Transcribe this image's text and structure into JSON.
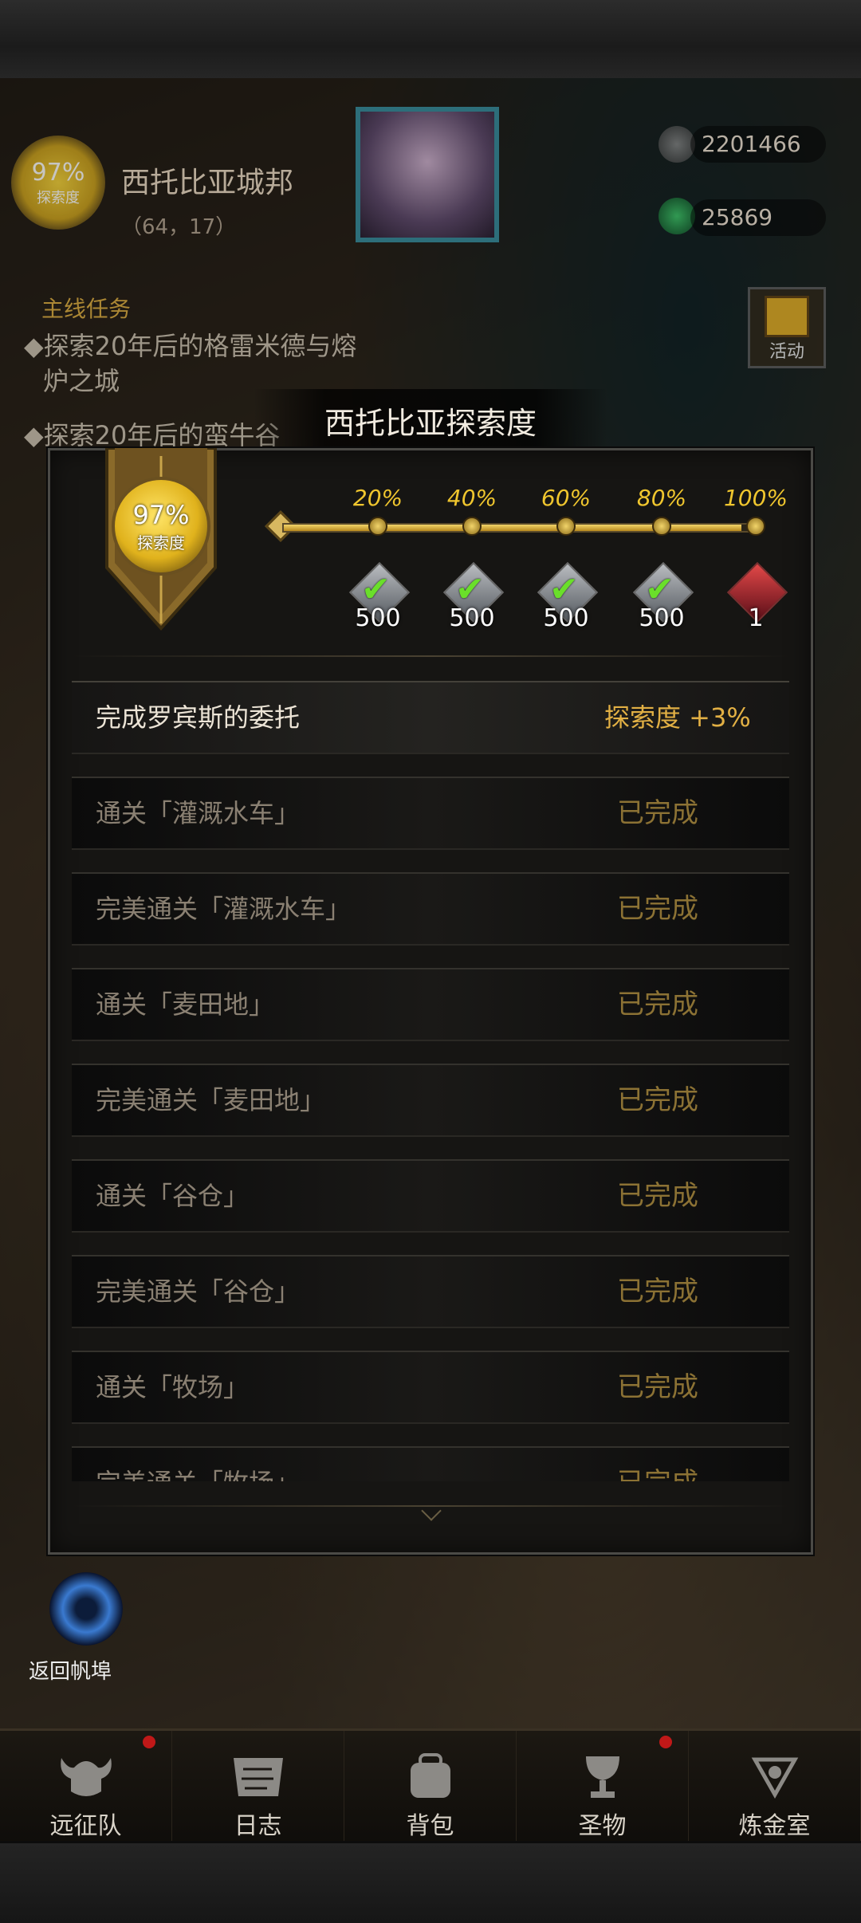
{
  "hud": {
    "explore_pct": "97%",
    "explore_label": "探索度",
    "city_name": "西托比亚城邦",
    "city_coord": "（64，17）",
    "resource_1": "2201466",
    "resource_2": "25869",
    "quest_title": "主线任务",
    "quest_1a": "◆探索20年后的格雷米德与熔",
    "quest_1b": "炉之城",
    "quest_2": "◆探索20年后的蛮牛谷",
    "gift_label": "活动",
    "portal_label": "返回帆埠"
  },
  "modal": {
    "title": "西托比亚探索度",
    "badge_pct": "97%",
    "badge_label": "探索度",
    "progress": 0.97,
    "milestones": [
      {
        "pct": "20%",
        "count": "500",
        "claimed": true,
        "type": "silver-gem"
      },
      {
        "pct": "40%",
        "count": "500",
        "claimed": true,
        "type": "silver-gem"
      },
      {
        "pct": "60%",
        "count": "500",
        "claimed": true,
        "type": "silver-gem"
      },
      {
        "pct": "80%",
        "count": "500",
        "claimed": true,
        "type": "silver-gem"
      },
      {
        "pct": "100%",
        "count": "1",
        "claimed": false,
        "type": "red-potion"
      }
    ],
    "tasks": [
      {
        "name": "完成罗宾斯的委托",
        "status": "探索度 +3%"
      },
      {
        "name": "通关「灌溉水车」",
        "status": "已完成"
      },
      {
        "name": "完美通关「灌溉水车」",
        "status": "已完成"
      },
      {
        "name": "通关「麦田地」",
        "status": "已完成"
      },
      {
        "name": "完美通关「麦田地」",
        "status": "已完成"
      },
      {
        "name": "通关「谷仓」",
        "status": "已完成"
      },
      {
        "name": "完美通关「谷仓」",
        "status": "已完成"
      },
      {
        "name": "通关「牧场」",
        "status": "已完成"
      },
      {
        "name": "完美通关「牧场」",
        "status": "已完成"
      }
    ]
  },
  "nav": [
    {
      "label": "远征队",
      "icon": "viking-helmet-icon",
      "badge": true
    },
    {
      "label": "日志",
      "icon": "map-scroll-icon",
      "badge": false
    },
    {
      "label": "背包",
      "icon": "backpack-icon",
      "badge": false
    },
    {
      "label": "圣物",
      "icon": "chalice-icon",
      "badge": true
    },
    {
      "label": "炼金室",
      "icon": "alchemy-icon",
      "badge": false
    }
  ]
}
